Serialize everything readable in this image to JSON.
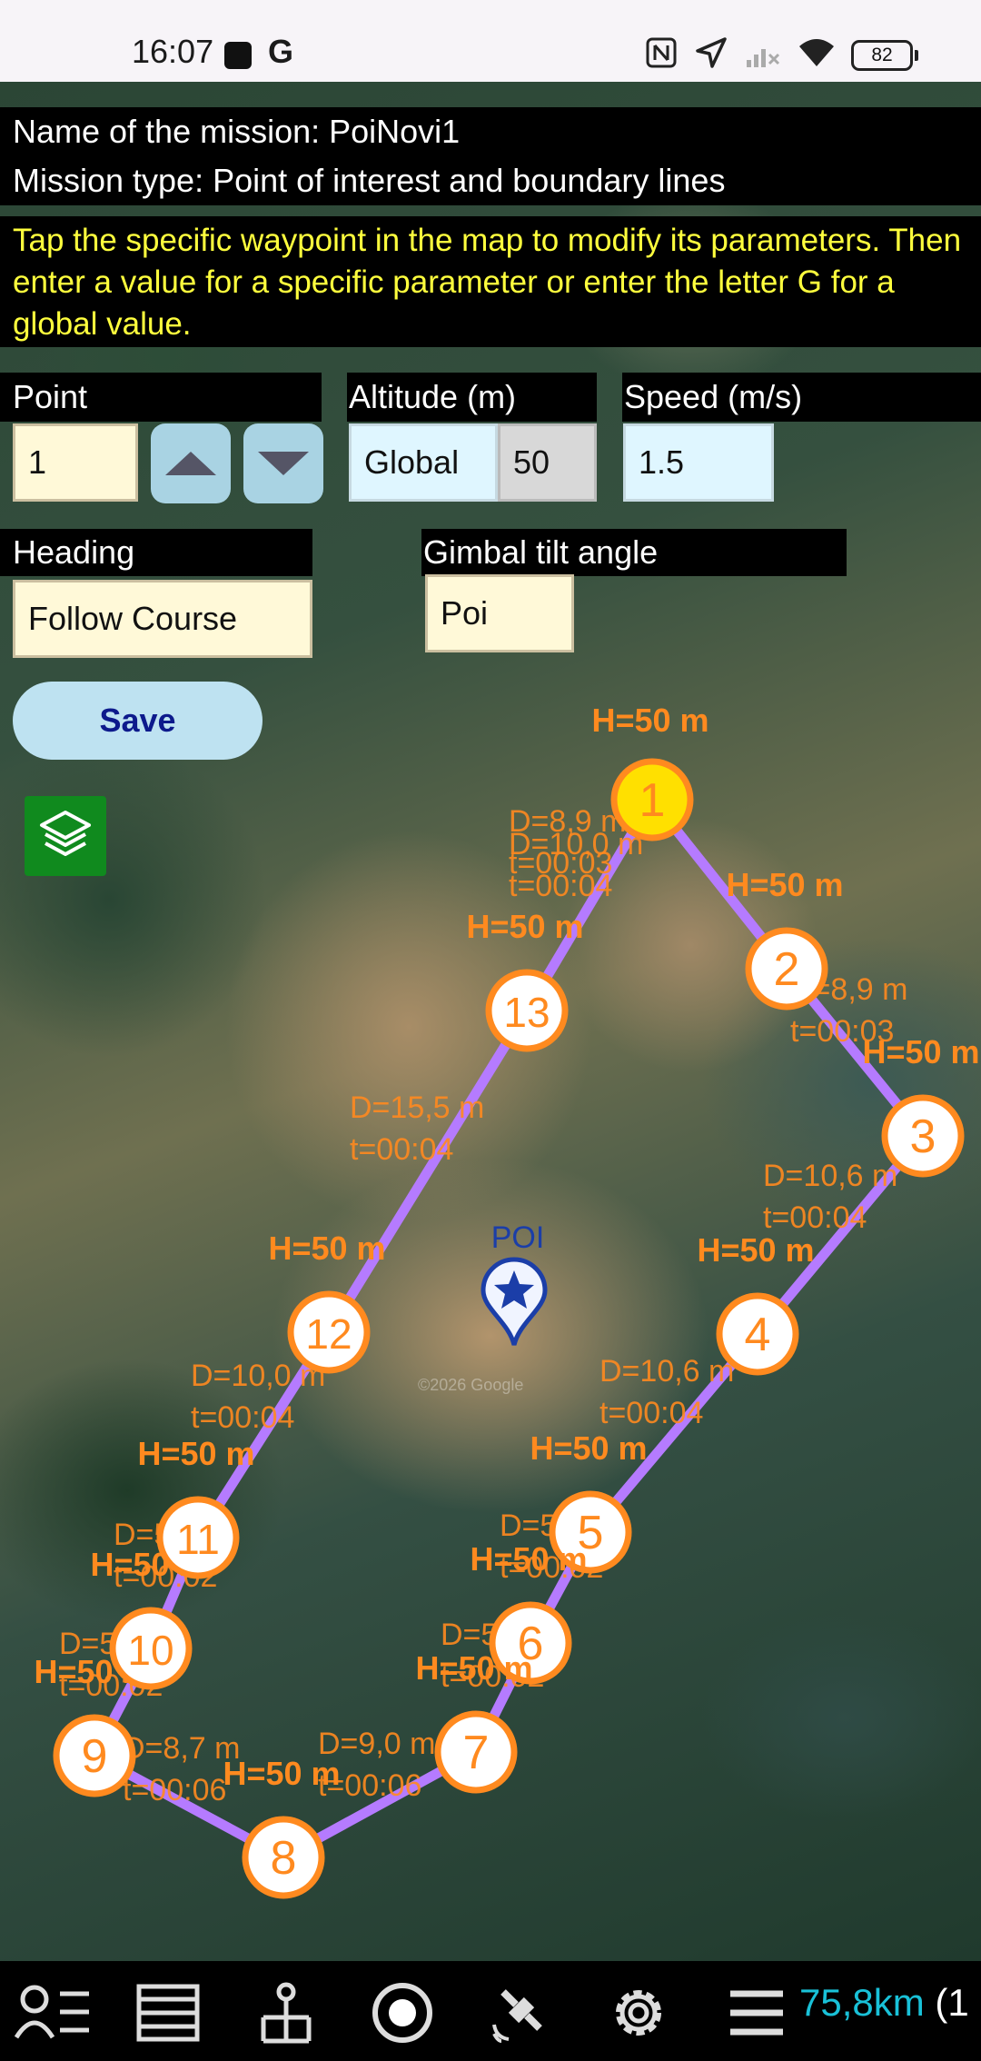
{
  "status_bar": {
    "time": "16:07",
    "battery": "82"
  },
  "mission": {
    "name_line": "Name of the mission: PoiNovi1",
    "type_line": "Mission type: Point of interest and boundary lines",
    "instructions": "Tap the specific waypoint in the map to modify its parameters. Then enter a value for a specific parameter or enter the letter G for a global value."
  },
  "form": {
    "point_label": "Point",
    "point_value": "1",
    "altitude_label": "Altitude (m)",
    "altitude_mode": "Global",
    "altitude_value": "50",
    "speed_label": "Speed (m/s)",
    "speed_value": "1.5",
    "heading_label": "Heading",
    "heading_value": "Follow Course",
    "gimbal_label": "Gimbal tilt angle",
    "gimbal_value": "Poi",
    "save_label": "Save"
  },
  "map": {
    "poi_label": "POI",
    "watermark": "©2026 Google",
    "waypoints": [
      {
        "num": "1",
        "height": "H=50 m",
        "selected": true
      },
      {
        "num": "2",
        "height": "H=50 m"
      },
      {
        "num": "3",
        "height": "H=50 m"
      },
      {
        "num": "4",
        "height": "H=50 m"
      },
      {
        "num": "5",
        "height": "H=50 m"
      },
      {
        "num": "6",
        "height": "H=50 m"
      },
      {
        "num": "7",
        "height": "H=50 m"
      },
      {
        "num": "8",
        "height": "H=50 m"
      },
      {
        "num": "9",
        "height": "H=50 m"
      },
      {
        "num": "10",
        "height": "H=50 m"
      },
      {
        "num": "11",
        "height": "H=50 m"
      },
      {
        "num": "12",
        "height": "H=50 m"
      },
      {
        "num": "13",
        "height": "H=50 m"
      }
    ],
    "segments": [
      {
        "dist": "D=8,9 m",
        "time": "t=00:03"
      },
      {
        "dist": "D=8,9 m",
        "time": "t=00:03"
      },
      {
        "dist": "D=10,6 m",
        "time": "t=00:04"
      },
      {
        "dist": "D=10,6 m",
        "time": "t=00:04"
      },
      {
        "dist": "D=5,2m",
        "time": "t=00:02"
      },
      {
        "dist": "D=5,1m",
        "time": "t=00:02"
      },
      {
        "dist": "D=9,0 m",
        "time": "t=00:06"
      },
      {
        "dist": "D=8,7 m",
        "time": "t=00:06"
      },
      {
        "dist": "D=5,1m",
        "time": "t=00:02"
      },
      {
        "dist": "D=5,1m",
        "time": "t=00:02"
      },
      {
        "dist": "D=10,0 m",
        "time": "t=00:04"
      },
      {
        "dist": "D=15,5 m",
        "time": "t=00:04"
      },
      {
        "dist": "D=10,0 m",
        "time": "t=00:04"
      }
    ]
  },
  "nav": {
    "distance": "75,8km",
    "extra": "(1",
    "icons": [
      "user-list-icon",
      "list-icon",
      "survey-icon",
      "record-icon",
      "satellite-icon",
      "settings-icon",
      "menu-icon"
    ]
  },
  "colors": {
    "route": "#b57bff",
    "waypoint": "#ff8a1f",
    "selected": "#ffe000",
    "hint": "#ffff3d",
    "distance": "#19c1d8"
  }
}
